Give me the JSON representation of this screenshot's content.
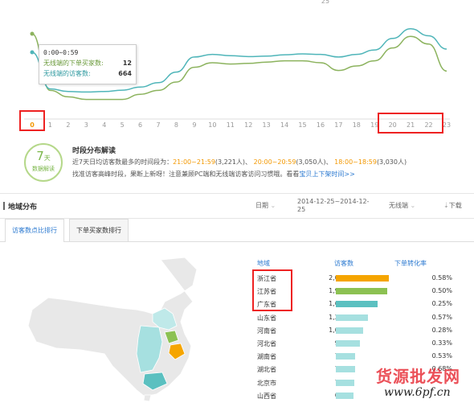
{
  "chart_data": {
    "type": "line",
    "x": [
      0,
      1,
      2,
      3,
      4,
      5,
      6,
      7,
      8,
      9,
      10,
      11,
      12,
      13,
      14,
      15,
      16,
      17,
      18,
      19,
      20,
      21,
      22,
      23
    ],
    "series": [
      {
        "name": "无线端的下单买家数",
        "color": "#8cb35e",
        "values": [
          12,
          3.2,
          2.2,
          1.8,
          1.8,
          1.8,
          2.6,
          3.2,
          4.5,
          6.8,
          7.5,
          7.3,
          7.4,
          7.6,
          7.8,
          7.8,
          7.5,
          6.3,
          7.0,
          7.8,
          9.8,
          11.6,
          10.4,
          6.2
        ]
      },
      {
        "name": "无线端的访客数",
        "color": "#4fb5b9",
        "values": [
          664,
          250,
          220,
          215,
          220,
          235,
          270,
          320,
          440,
          610,
          640,
          625,
          615,
          620,
          635,
          645,
          640,
          610,
          640,
          690,
          820,
          930,
          850,
          700
        ]
      }
    ],
    "x_visible_labels": [
      "0",
      "1",
      "2",
      "3",
      "4",
      "5",
      "6",
      "7",
      "8",
      "9",
      "10",
      "11",
      "12",
      "13",
      "14",
      "15",
      "16",
      "17",
      "18",
      "19",
      "20",
      "21",
      "22",
      "23"
    ],
    "top_partial_label": "25"
  },
  "tooltip": {
    "time": "0:00~0:59",
    "buyers_label": "无线端的下单买家数:",
    "buyers_value": "12",
    "visitors_label": "无线端的访客数:",
    "visitors_value": "664"
  },
  "badge": {
    "number": "7",
    "unit": "天",
    "sub": "数据解读"
  },
  "interpretation": {
    "title": "时段分布解读",
    "line1_prefix": "近7天日均访客数最多的时间段为：",
    "slot1": "21:00~21:59",
    "slot1_count": "(3,221人)、",
    "slot2": "20:00~20:59",
    "slot2_count": "(3,050人)、",
    "slot3": "18:00~18:59",
    "slot3_count": "(3,030人)",
    "line2": "找准访客高峰时段，果断上新呀！注意兼顾PC端和无线端访客访问习惯哦。看看",
    "link": "宝贝上下架时间>>"
  },
  "section": {
    "title": "地域分布",
    "date_label": "日期",
    "date_range_line1": "2014-12-25~2014-12-",
    "date_range_line2": "25",
    "terminal": "无线端",
    "download": "下载"
  },
  "tabs": [
    "访客数点比排行",
    "下单买家数排行"
  ],
  "table": {
    "headers": {
      "region": "地域",
      "visitors": "访客数",
      "conversion": "下单转化率"
    },
    "max_visitors": 2058,
    "rows": [
      {
        "province": "浙江省",
        "visitors": "2,058",
        "value": 2058,
        "conversion": "0.58%",
        "color": "#f5a500"
      },
      {
        "province": "江苏省",
        "visitors": "1,988",
        "value": 1988,
        "conversion": "0.50%",
        "color": "#8cc152"
      },
      {
        "province": "广东省",
        "visitors": "1,612",
        "value": 1612,
        "conversion": "0.25%",
        "color": "#5bc0c0"
      },
      {
        "province": "山东省",
        "visitors": "1,232",
        "value": 1232,
        "conversion": "0.57%",
        "color": "#a6e0e0"
      },
      {
        "province": "河南省",
        "visitors": "1,059",
        "value": 1059,
        "conversion": "0.28%",
        "color": "#a6e0e0"
      },
      {
        "province": "河北省",
        "visitors": "920",
        "value": 920,
        "conversion": "0.33%",
        "color": "#a6e0e0"
      },
      {
        "province": "湖南省",
        "visitors": "755",
        "value": 755,
        "conversion": "0.53%",
        "color": "#a6e0e0"
      },
      {
        "province": "湖北省",
        "visitors": "735",
        "value": 735,
        "conversion": "0.68%",
        "color": "#a6e0e0"
      },
      {
        "province": "北京市",
        "visitors": "732",
        "value": 732,
        "conversion": "",
        "color": "#a6e0e0"
      },
      {
        "province": "山西省",
        "visitors": "695",
        "value": 695,
        "conversion": "",
        "color": "#a6e0e0"
      }
    ]
  },
  "watermark": {
    "cn": "货源批发网",
    "url": "www.6pf.cn"
  }
}
